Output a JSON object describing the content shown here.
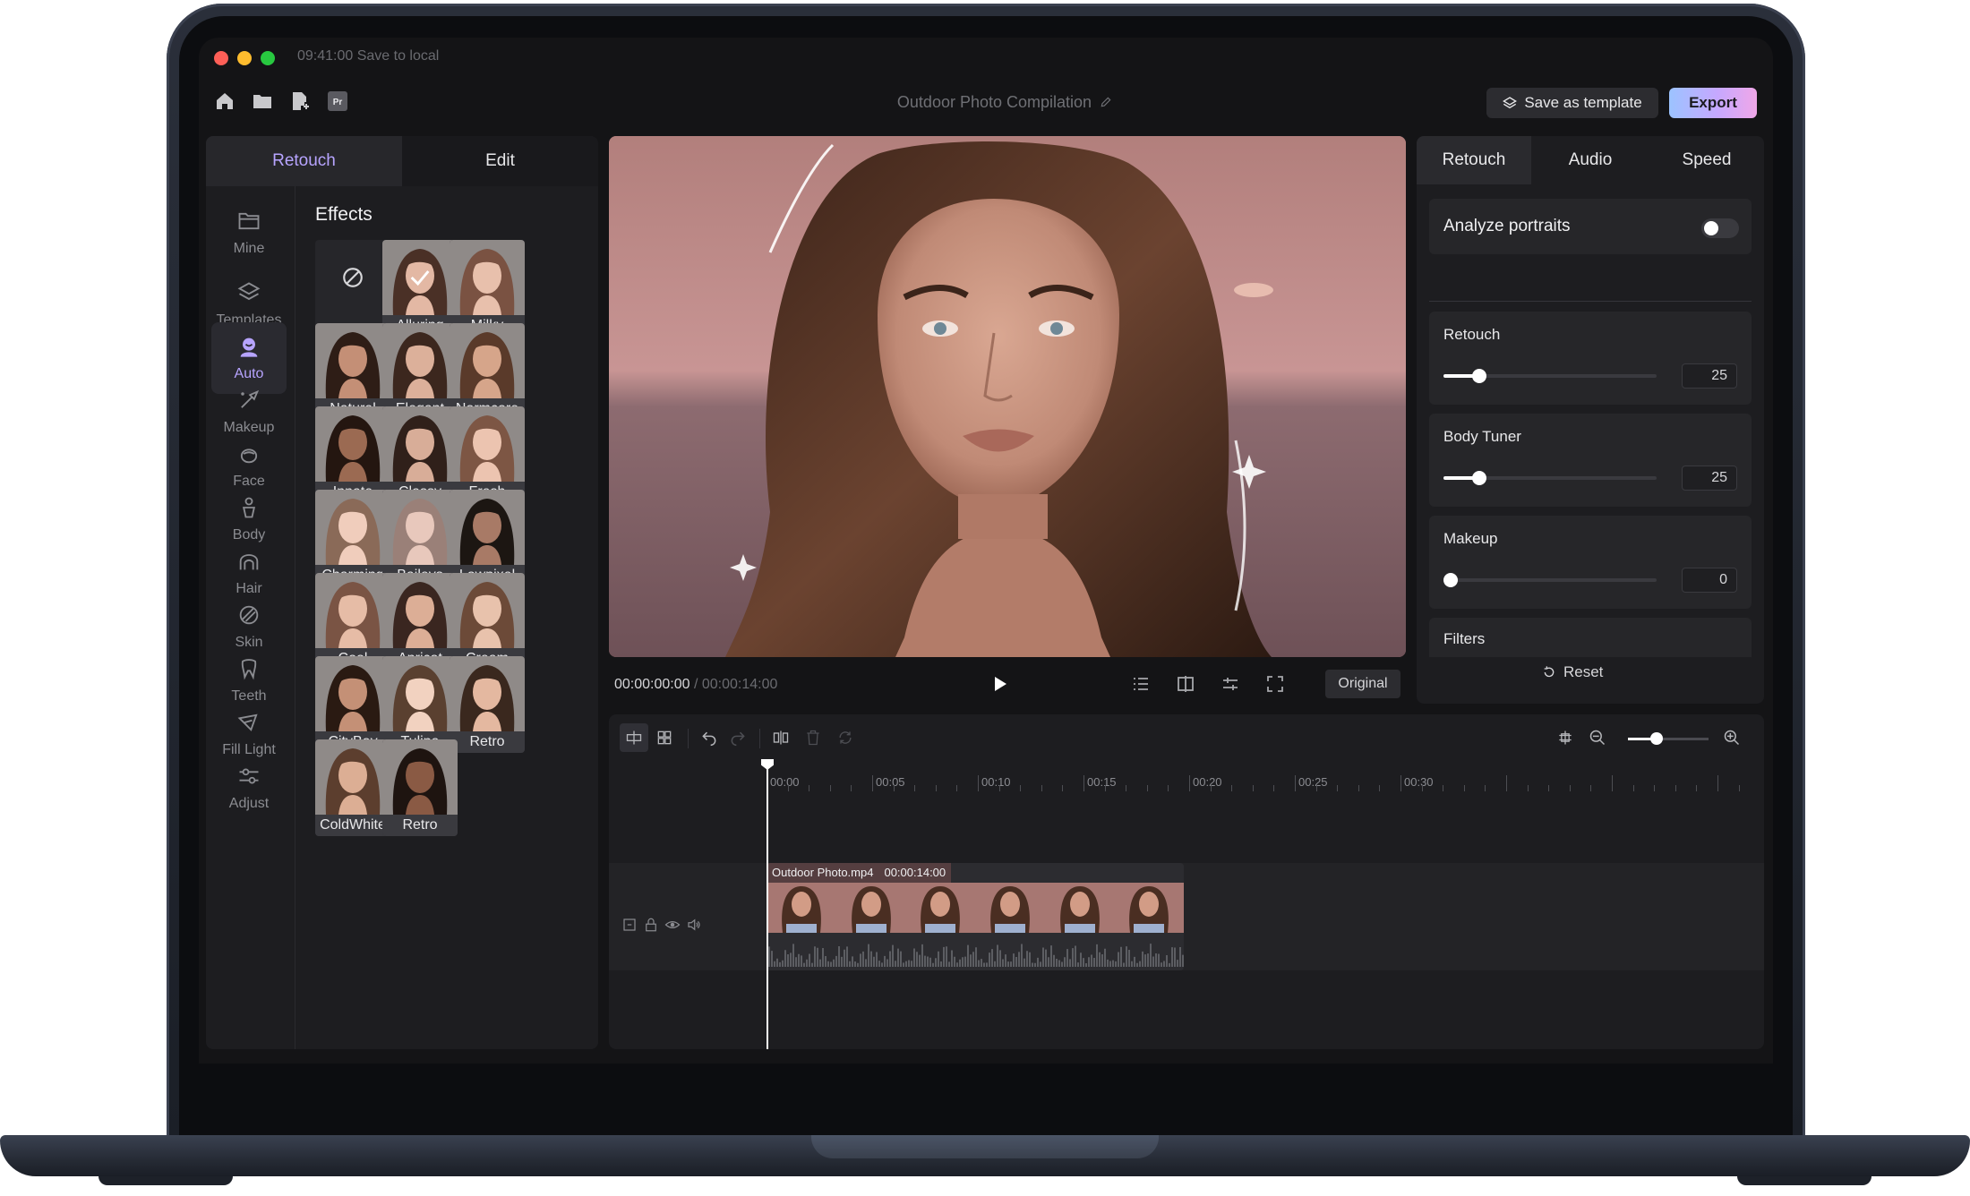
{
  "titlebar": {
    "save_status": "09:41:00 Save to local"
  },
  "toolbar": {
    "project_title": "Outdoor Photo Compilation",
    "save_template_label": "Save as template",
    "export_label": "Export",
    "icons": [
      "home-icon",
      "folder-icon",
      "new-file-icon",
      "premiere-icon"
    ],
    "premiere_badge": "Pr"
  },
  "left_panel": {
    "tabs": [
      {
        "label": "Retouch",
        "active": true
      },
      {
        "label": "Edit",
        "active": false
      }
    ],
    "nav": [
      {
        "label": "Mine",
        "icon": "folder-icon"
      },
      {
        "label": "Templates",
        "icon": "layers-icon"
      },
      {
        "label": "Auto",
        "icon": "auto-portrait-icon",
        "active": true
      },
      {
        "label": "Makeup",
        "icon": "makeup-brush-icon"
      },
      {
        "label": "Face",
        "icon": "face-icon"
      },
      {
        "label": "Body",
        "icon": "body-icon"
      },
      {
        "label": "Hair",
        "icon": "hair-icon"
      },
      {
        "label": "Skin",
        "icon": "skin-icon"
      },
      {
        "label": "Teeth",
        "icon": "tooth-icon"
      },
      {
        "label": "Fill Light",
        "icon": "fill-light-icon"
      },
      {
        "label": "Adjust",
        "icon": "adjust-sliders-icon"
      }
    ],
    "effects_title": "Effects",
    "effects": [
      {
        "label": "",
        "type": "none"
      },
      {
        "label": "Alluring",
        "selected": true
      },
      {
        "label": "Milky"
      },
      {
        "label": "Natural"
      },
      {
        "label": "Elegant"
      },
      {
        "label": "Normcore"
      },
      {
        "label": "Innate"
      },
      {
        "label": "Classy"
      },
      {
        "label": "Fresh"
      },
      {
        "label": "Charming"
      },
      {
        "label": "Baileys"
      },
      {
        "label": "Lowpixel"
      },
      {
        "label": "Cool"
      },
      {
        "label": "Apricot"
      },
      {
        "label": "Cream"
      },
      {
        "label": "CityBoy"
      },
      {
        "label": "Tulipa"
      },
      {
        "label": "Retro"
      },
      {
        "label": "ColdWhite"
      },
      {
        "label": "Retro"
      }
    ]
  },
  "player": {
    "current_time": "00:00:00:00",
    "total_time": " / 00:00:14:00",
    "original_label": "Original",
    "icons": [
      "list-icon",
      "compare-icon",
      "adjust-icon",
      "fullscreen-icon"
    ]
  },
  "right_panel": {
    "tabs": [
      {
        "label": "Retouch",
        "active": true
      },
      {
        "label": "Audio"
      },
      {
        "label": "Speed"
      }
    ],
    "analyze_label": "Analyze portraits",
    "analyze_on": false,
    "sliders": [
      {
        "label": "Retouch",
        "value": "25",
        "fraction": 0.17
      },
      {
        "label": "Body Tuner",
        "value": "25",
        "fraction": 0.17
      },
      {
        "label": "Makeup",
        "value": "0",
        "fraction": 0
      }
    ],
    "filters_label": "Filters",
    "reset_label": "Reset"
  },
  "timeline": {
    "ticks": [
      "00:00",
      "00:05",
      "00:10",
      "00:15",
      "00:20",
      "00:25",
      "00:30"
    ],
    "clip_name": "Outdoor Photo.mp4",
    "clip_duration": "00:00:14:00",
    "zoom_fraction": 0.35
  },
  "colors": {
    "accent": "#b7a4ff",
    "export_gradient": [
      "#9cc3ff",
      "#c6a8ff",
      "#f0a7e8"
    ],
    "background": "#141416",
    "panel": "#1d1d20"
  }
}
